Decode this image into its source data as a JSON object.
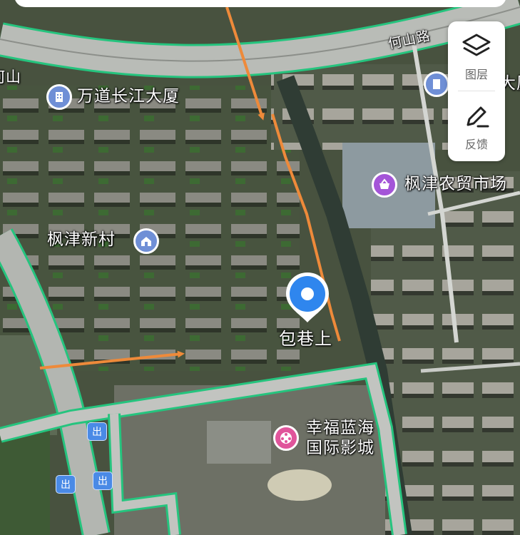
{
  "map": {
    "roads": {
      "road_north": "何山路",
      "road_left_fragment": "何山"
    },
    "pois": [
      {
        "id": "office",
        "label": "万道长江大厦",
        "icon": "building-icon",
        "color": "#6f8fd6"
      },
      {
        "id": "market",
        "label": "枫津农贸市场",
        "icon": "market-icon",
        "color": "#a455d8"
      },
      {
        "id": "village",
        "label": "枫津新村",
        "icon": "residential-icon",
        "color": "#6f8fd6"
      },
      {
        "id": "cinema",
        "label_line1": "幸福蓝海",
        "label_line2": "国际影城",
        "icon": "cinema-icon",
        "color": "#e0559b"
      },
      {
        "id": "right-partial",
        "label": "大厦",
        "icon": "building-icon",
        "color": "#6f8fd6"
      }
    ],
    "current_location": {
      "label": "包巷上",
      "icon": "location-pin-icon",
      "color": "#2f86ee"
    },
    "exits": [
      "出",
      "出",
      "出"
    ]
  },
  "toolbar": {
    "layers_label": "图层",
    "feedback_label": "反馈"
  },
  "colors": {
    "road_outline": "#25c47e",
    "route_arrow": "#ee8a3a",
    "pin": "#2f86ee"
  }
}
